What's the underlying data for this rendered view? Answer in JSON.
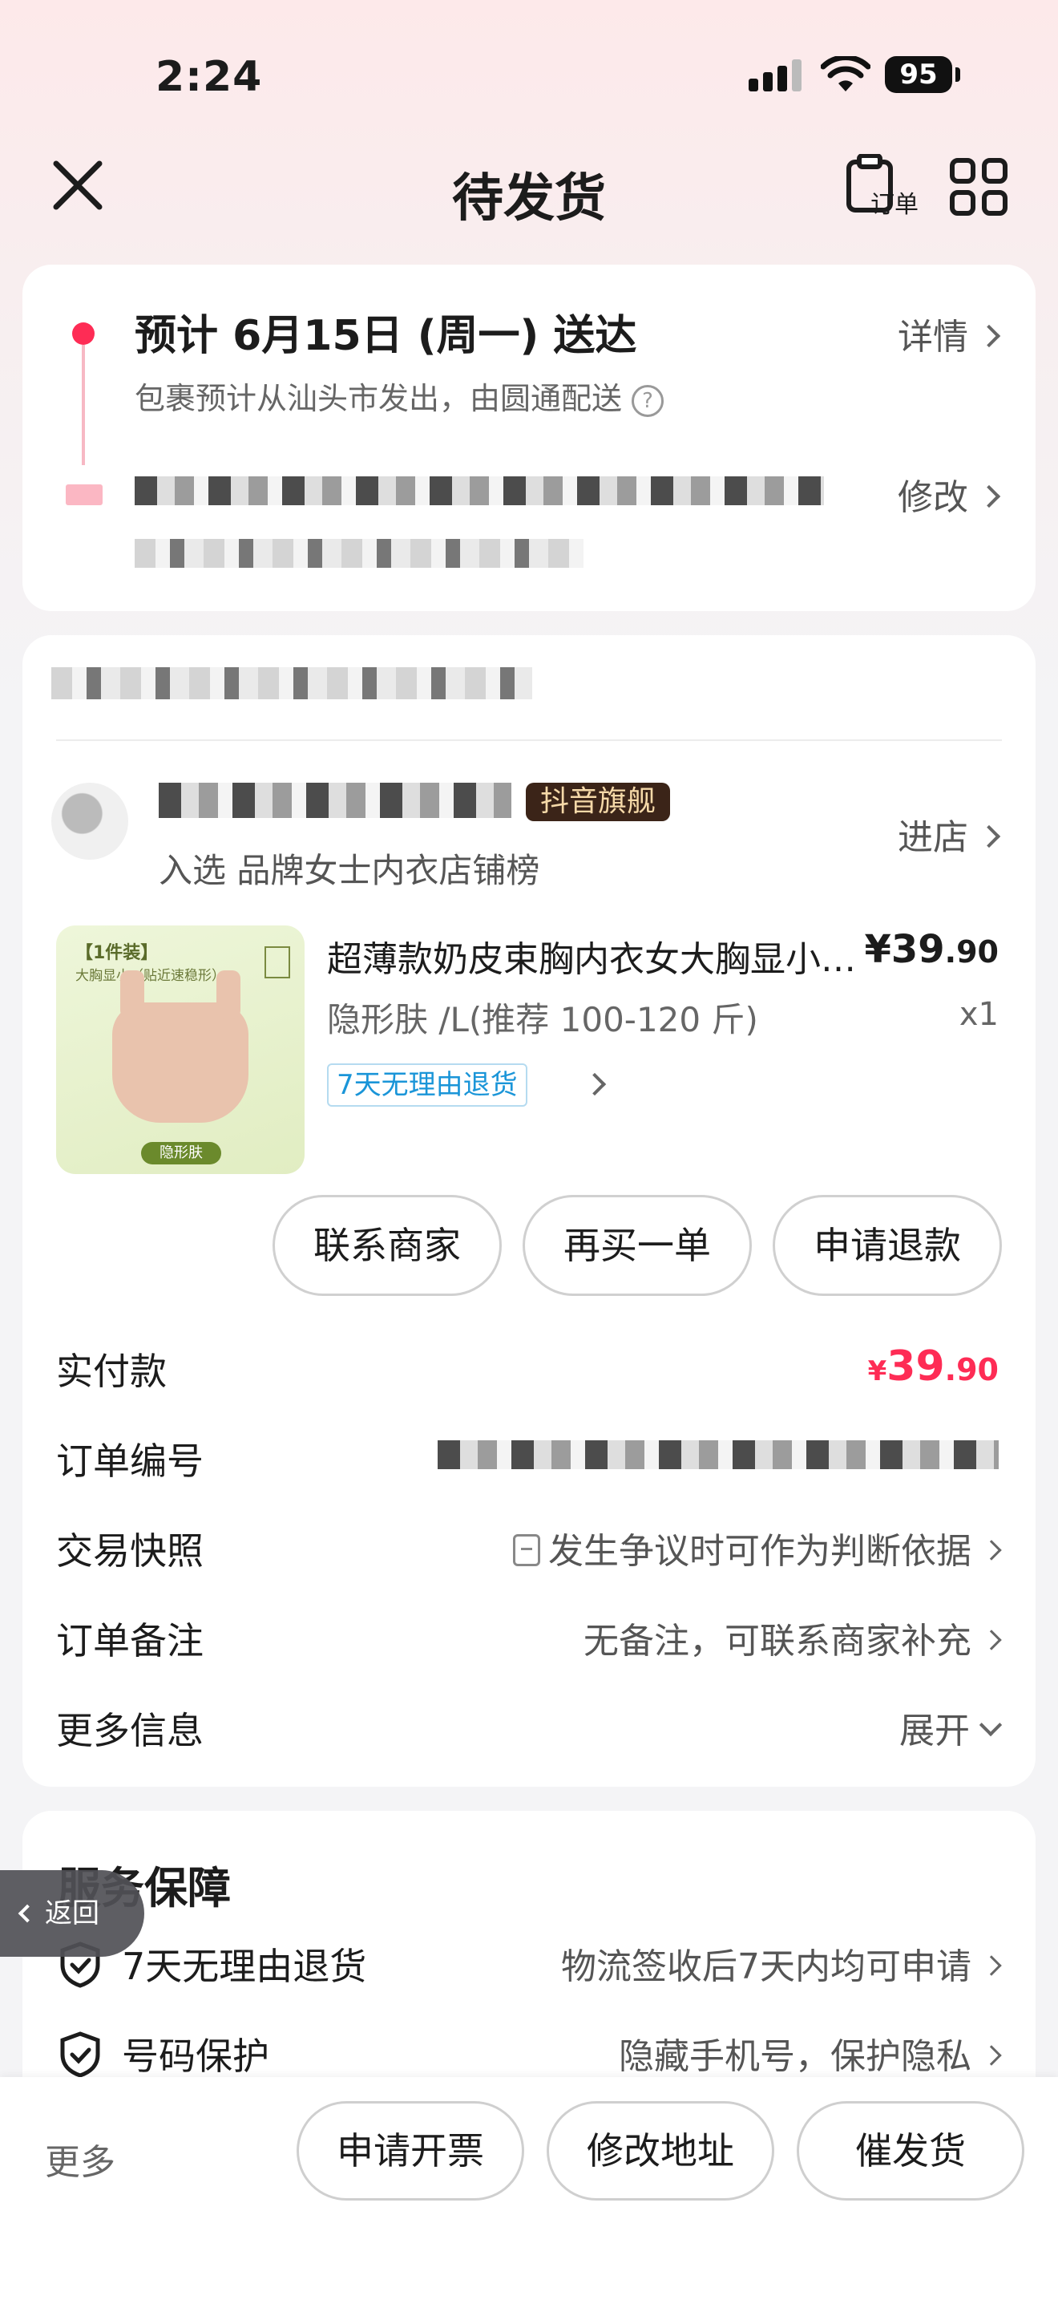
{
  "status_bar": {
    "time": "2:24",
    "battery": "95"
  },
  "nav": {
    "title": "待发货",
    "order_icon_label": "订单"
  },
  "delivery": {
    "title": "预计 6月15日 (周一) 送达",
    "subtitle": "包裹预计从汕头市发出，由圆通配送",
    "detail_link": "详情",
    "modify_link": "修改"
  },
  "shop": {
    "badge": "抖音旗舰",
    "rank_text": "入选 品牌女士内衣店铺榜",
    "enter_link": "进店"
  },
  "product": {
    "image_tag": "【1件装】",
    "image_subtag": "大胸显小（贴近速稳形）",
    "image_band": "隐形肤",
    "title": "超薄款奶皮束胸内衣女大胸显小无钢圈",
    "price_int": "¥39",
    "price_dec": ".90",
    "sku": "隐形肤 /L(推荐 100-120 斤)",
    "qty": "x1",
    "return_tag": "7天无理由退货"
  },
  "actions": {
    "contact": "联系商家",
    "rebuy": "再买一单",
    "refund": "申请退款"
  },
  "info": {
    "paid_label": "实付款",
    "paid_yen": "¥",
    "paid_int": "39",
    "paid_dec": ".90",
    "order_no_label": "订单编号",
    "snapshot_label": "交易快照",
    "snapshot_value": "发生争议时可作为判断依据",
    "remark_label": "订单备注",
    "remark_value": "无备注，可联系商家补充",
    "more_label": "更多信息",
    "more_value": "展开"
  },
  "service": {
    "title": "服务保障",
    "rows": [
      {
        "label": "7天无理由退货",
        "value": "物流签收后7天内均可申请"
      },
      {
        "label": "号码保护",
        "value": "隐藏手机号，保护隐私"
      }
    ]
  },
  "back_pill": "返回",
  "bottom": {
    "more": "更多",
    "invoice": "申请开票",
    "modify_address": "修改地址",
    "urge": "催发货"
  },
  "colors": {
    "accent": "#fe2c55",
    "link_blue": "#1a95d8",
    "badge_bg": "#3b2418"
  }
}
